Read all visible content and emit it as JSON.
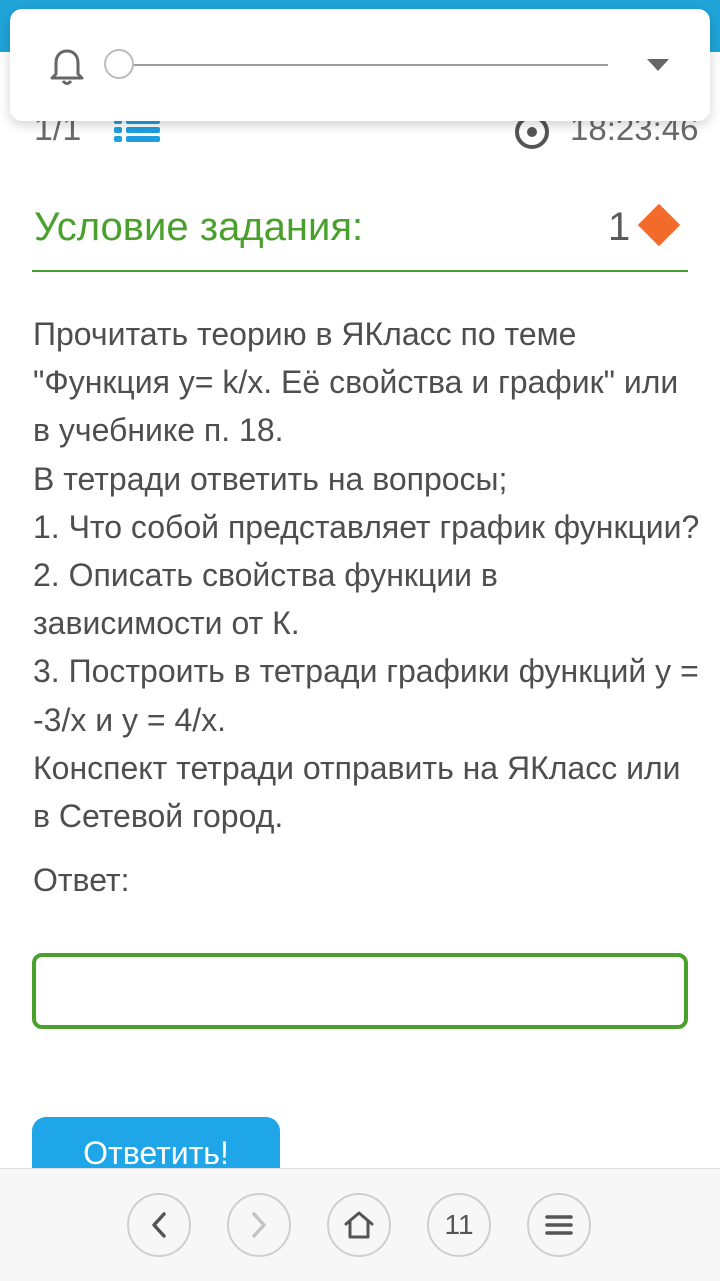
{
  "header": {
    "counter": "1/1",
    "timer": "18:23:46"
  },
  "task": {
    "title": "Условие задания:",
    "points": "1",
    "lines": [
      "Прочитать теорию в ЯКласс по теме",
      "\"Функция y= k/x. Её свойства и график\" или",
      "в учебнике п. 18.",
      "В тетради ответить на вопросы;",
      "1. Что собой представляет график функции?",
      "2. Описать свойства функции в",
      "зависимости от К.",
      "3. Построить в тетради графики функций y =",
      "-3/x и y = 4/x.",
      "Конспект тетради отправить на ЯКласс или",
      "в Сетевой город."
    ]
  },
  "answer": {
    "label": "Ответ:",
    "value": "",
    "submit_label": "Ответить!"
  },
  "browser_bar": {
    "tabs_count": "11"
  },
  "volume": {
    "level": 0
  },
  "colors": {
    "accent_green": "#4aa02c",
    "accent_blue": "#1fa6e8",
    "diamond": "#f26b2a"
  },
  "icons": [
    "bell-icon",
    "expand-icon",
    "list-icon",
    "timer-icon",
    "diamond-icon",
    "back-icon",
    "forward-icon",
    "home-icon",
    "menu-icon"
  ]
}
